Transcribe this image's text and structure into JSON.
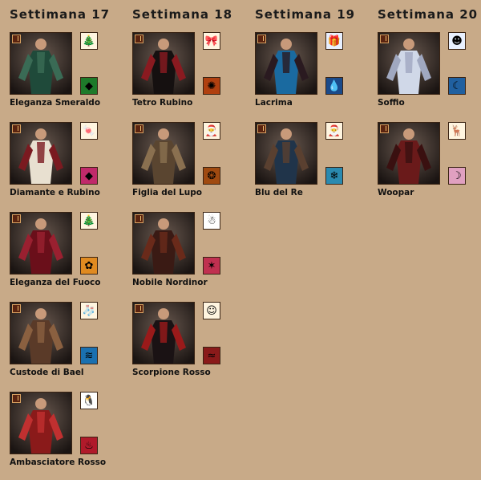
{
  "weeks": [
    {
      "title": "Settimana 17",
      "items": [
        {
          "name": "Eleganza Smeraldo",
          "image": "green-medieval-gown",
          "colors": [
            "#1f4a3a",
            "#3a6b55"
          ],
          "icons": [
            "christmas-tree-icon",
            "green-crystal-icon"
          ]
        },
        {
          "name": "Diamante e Rubino",
          "image": "white-red-gown",
          "colors": [
            "#e8e0d0",
            "#7a1a20"
          ],
          "icons": [
            "candy-cane-icon",
            "pink-crystal-icon"
          ]
        },
        {
          "name": "Eleganza del Fuoco",
          "image": "red-velvet-gown",
          "colors": [
            "#6a0f1a",
            "#9a2030"
          ],
          "icons": [
            "christmas-tree-icon",
            "orange-flower-icon"
          ]
        },
        {
          "name": "Custode di Bael",
          "image": "brown-tunic-outfit",
          "colors": [
            "#5a3a28",
            "#8a6040"
          ],
          "icons": [
            "stocking-icon",
            "water-swirl-icon"
          ]
        },
        {
          "name": "Ambasciatore Rosso",
          "image": "red-robe-outfit",
          "colors": [
            "#8a1a1a",
            "#c03030"
          ],
          "icons": [
            "penguin-icon",
            "red-flame-icon"
          ]
        }
      ]
    },
    {
      "title": "Settimana 18",
      "items": [
        {
          "name": "Tetro Rubino",
          "image": "black-red-gown",
          "colors": [
            "#151010",
            "#8a1a20"
          ],
          "icons": [
            "gift-bow-icon",
            "fire-disk-icon"
          ]
        },
        {
          "name": "Figlia del Lupo",
          "image": "fur-leather-outfit",
          "colors": [
            "#5a4530",
            "#8a7050"
          ],
          "icons": [
            "santa-icon",
            "paw-icon"
          ]
        },
        {
          "name": "Nobile Nordinor",
          "image": "hooded-cloak-outfit",
          "colors": [
            "#3a1a14",
            "#6a2a1a"
          ],
          "icons": [
            "snowman-icon",
            "pink-star-icon"
          ]
        },
        {
          "name": "Scorpione Rosso",
          "image": "red-armor-outfit",
          "colors": [
            "#1a1214",
            "#9a1a1a"
          ],
          "icons": [
            "gingerbread-icon",
            "claw-marks-icon"
          ]
        }
      ]
    },
    {
      "title": "Settimana 19",
      "items": [
        {
          "name": "Lacrima",
          "image": "blue-dress-outfit",
          "colors": [
            "#1a6aa0",
            "#2a1a20"
          ],
          "icons": [
            "present-icon",
            "water-drop-icon"
          ]
        },
        {
          "name": "Blu del Re",
          "image": "blue-cape-outfit",
          "colors": [
            "#20344a",
            "#5a4030"
          ],
          "icons": [
            "santa-face-icon",
            "ice-crystal-icon"
          ]
        }
      ]
    },
    {
      "title": "Settimana 20",
      "items": [
        {
          "name": "Soffio",
          "image": "white-silk-dress",
          "colors": [
            "#d0d8e8",
            "#a0a8c0"
          ],
          "icons": [
            "blue-character-icon",
            "crescent-wind-icon"
          ]
        },
        {
          "name": "Woopar",
          "image": "red-shirt-outfit",
          "colors": [
            "#6a1a1a",
            "#3a1010"
          ],
          "icons": [
            "reindeer-icon",
            "pink-crescent-icon"
          ]
        }
      ]
    }
  ]
}
